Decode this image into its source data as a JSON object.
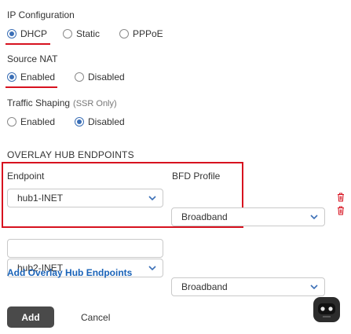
{
  "ip_config": {
    "label": "IP Configuration",
    "options": [
      "DHCP",
      "Static",
      "PPPoE"
    ],
    "selected": "DHCP"
  },
  "source_nat": {
    "label": "Source NAT",
    "options": [
      "Enabled",
      "Disabled"
    ],
    "selected": "Enabled"
  },
  "traffic_shaping": {
    "label": "Traffic Shaping",
    "note": "(SSR Only)",
    "options": [
      "Enabled",
      "Disabled"
    ],
    "selected": "Disabled"
  },
  "overlay": {
    "heading": "OVERLAY HUB ENDPOINTS",
    "col_endpoint": "Endpoint",
    "col_bfd": "BFD Profile",
    "rows": [
      {
        "endpoint": "hub1-INET",
        "bfd": "Broadband"
      },
      {
        "endpoint": "hub2-INET",
        "bfd": "Broadband"
      }
    ],
    "add_link": "Add Overlay Hub Endpoints"
  },
  "footer": {
    "add_label": "Add",
    "cancel_label": "Cancel"
  },
  "colors": {
    "accent": "#3b6fb6",
    "highlight": "#d7121f",
    "link": "#1a63b8",
    "trash": "#d7121f"
  },
  "icons": [
    "chevron-down-icon",
    "trash-icon",
    "bot-icon"
  ]
}
